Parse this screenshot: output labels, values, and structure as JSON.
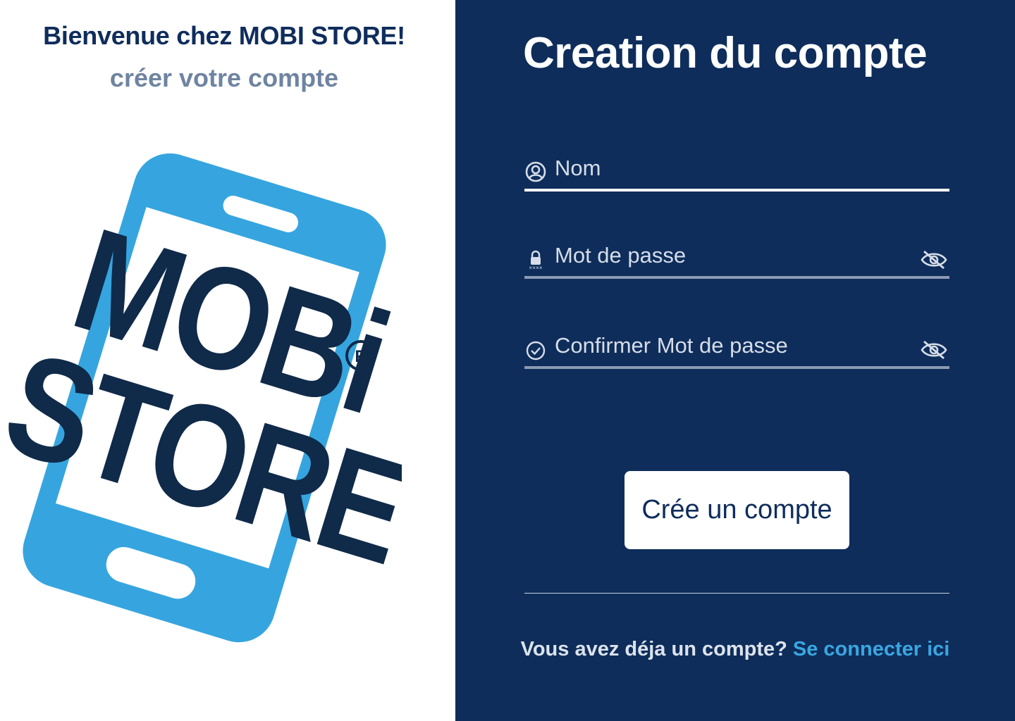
{
  "left_panel": {
    "welcome": "Bienvenue chez MOBI STORE!",
    "subtitle": "créer votre compte",
    "logo": {
      "line1": "MOBi",
      "line2": "STORE",
      "registered": "R"
    }
  },
  "form": {
    "title": "Creation du compte",
    "fields": [
      {
        "placeholder": "Nom",
        "icon": "user-circle-icon"
      },
      {
        "placeholder": "Mot de passe",
        "icon": "lock-password-icon",
        "toggle_icon": "eye-off-icon"
      },
      {
        "placeholder": "Confirmer Mot de passe",
        "icon": "check-circle-icon",
        "toggle_icon": "eye-off-icon"
      }
    ],
    "submit_label": "Crée un compte",
    "login_prompt": "Vous avez déja un compte?",
    "login_link": "Se connecter ici"
  },
  "colors": {
    "navy": "#0e2d5b",
    "phone_blue": "#36a5df",
    "link_blue": "#3aa6e0",
    "muted_text": "#6f84a1"
  }
}
